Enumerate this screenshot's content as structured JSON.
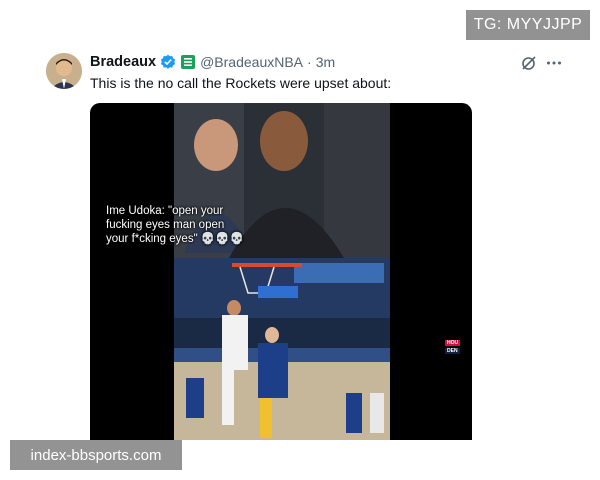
{
  "tweet": {
    "display_name": "Bradeaux",
    "handle": "@BradeauxNBA",
    "separator": "·",
    "time": "3m",
    "text": "This is the no call the Rockets were upset about:",
    "icons": {
      "avatar": "avatar",
      "verified": "verified-check-icon",
      "affiliate": "affiliate-badge-icon",
      "grok": "grok-icon",
      "more": "more-options-icon"
    },
    "media": {
      "caption_lines": [
        "Ime Udoka: \"open your",
        "fucking eyes man open",
        "your f*cking eyes\" 💀💀💀"
      ],
      "scorebug": {
        "team_top": "HOU",
        "team_bottom": "DEN"
      }
    }
  },
  "watermarks": {
    "top_right": "TG: MYYJJPP",
    "bottom_left": "index-bbsports.com"
  },
  "colors": {
    "verified_blue": "#1d9bf0",
    "text_primary": "#0f1419",
    "text_secondary": "#536471",
    "affiliate_green": "#1aa05b"
  }
}
